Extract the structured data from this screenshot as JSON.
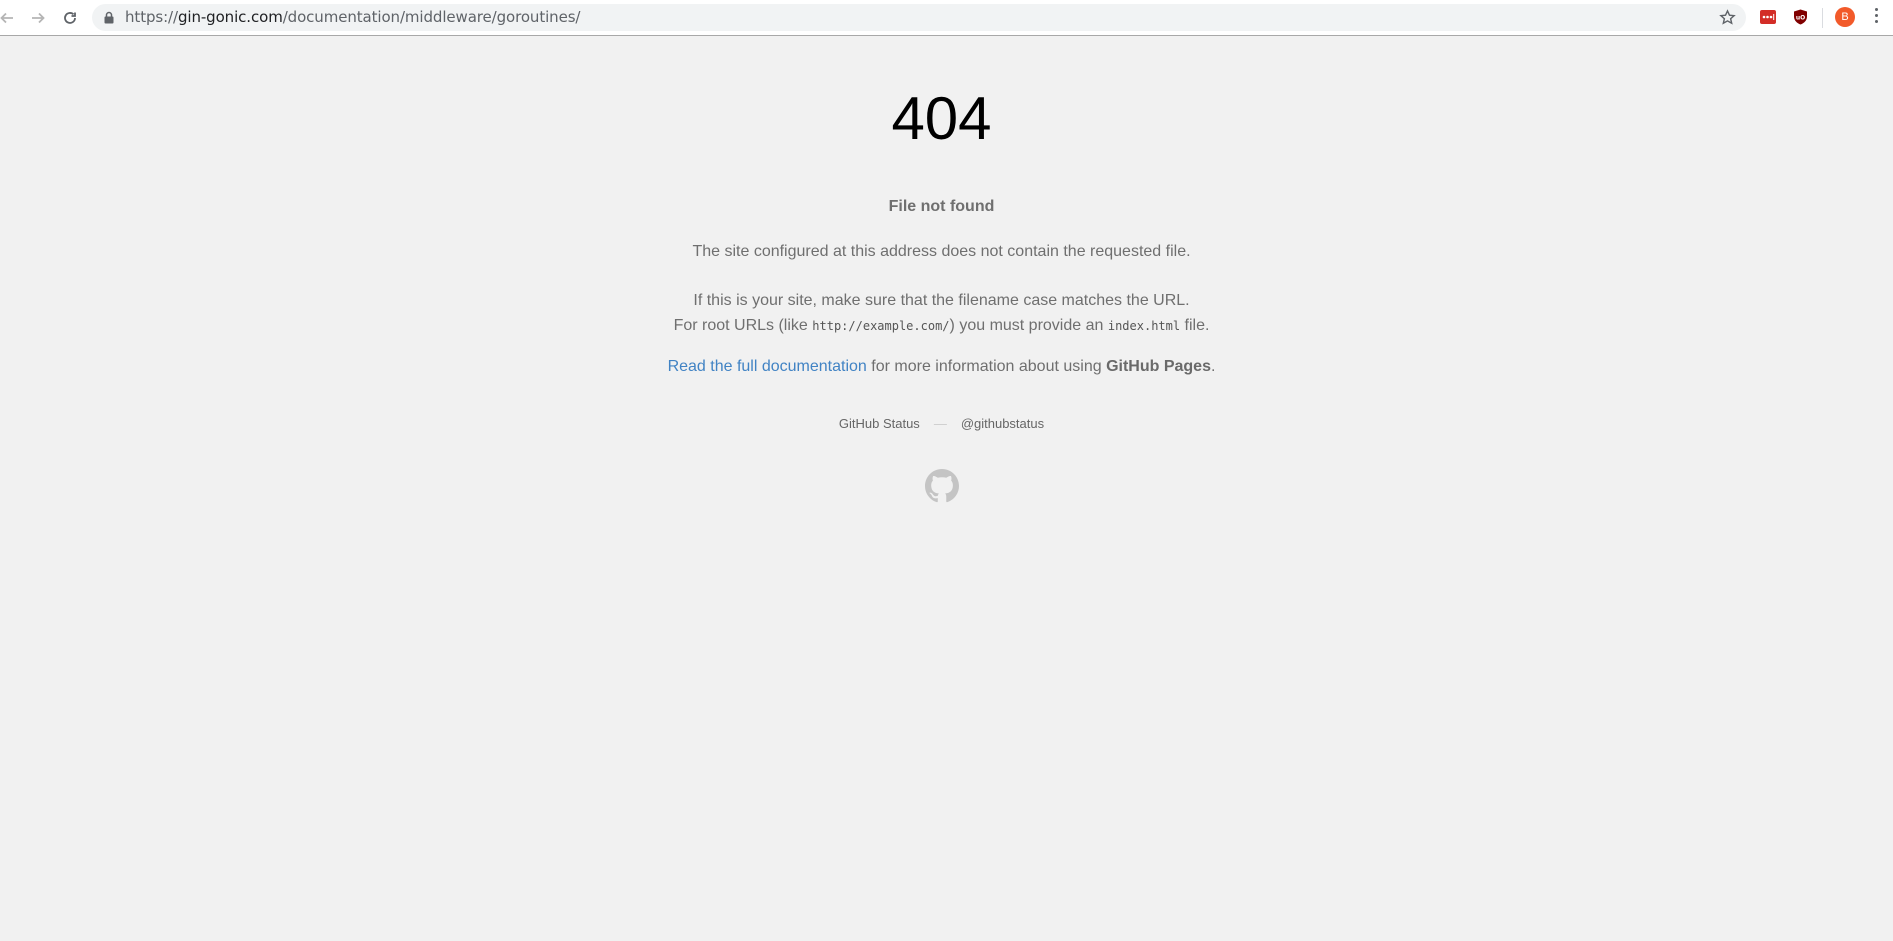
{
  "browser": {
    "url_scheme": "https://",
    "url_host": "gin-gonic.com",
    "url_path": "/documentation/middleware/goroutines/",
    "avatar_letter": "B",
    "accent_avatar": "#f25a2a"
  },
  "error_page": {
    "code": "404",
    "headline": "File not found",
    "message": "The site configured at this address does not contain the requested file.",
    "case_line": "If this is your site, make sure that the filename case matches the URL.",
    "root_prefix": "For root URLs (like ",
    "root_example": "http://example.com/",
    "root_middle": ") you must provide an ",
    "root_file": "index.html",
    "root_suffix": " file.",
    "docs_link": "Read the full documentation",
    "docs_middle": " for more information about using ",
    "docs_product": "GitHub Pages",
    "docs_end": ".",
    "link_color": "#4183c4"
  },
  "footer": {
    "status_link": "GitHub Status",
    "separator": "—",
    "twitter_link": "@githubstatus",
    "logo_icon": "github-octocat-icon"
  }
}
